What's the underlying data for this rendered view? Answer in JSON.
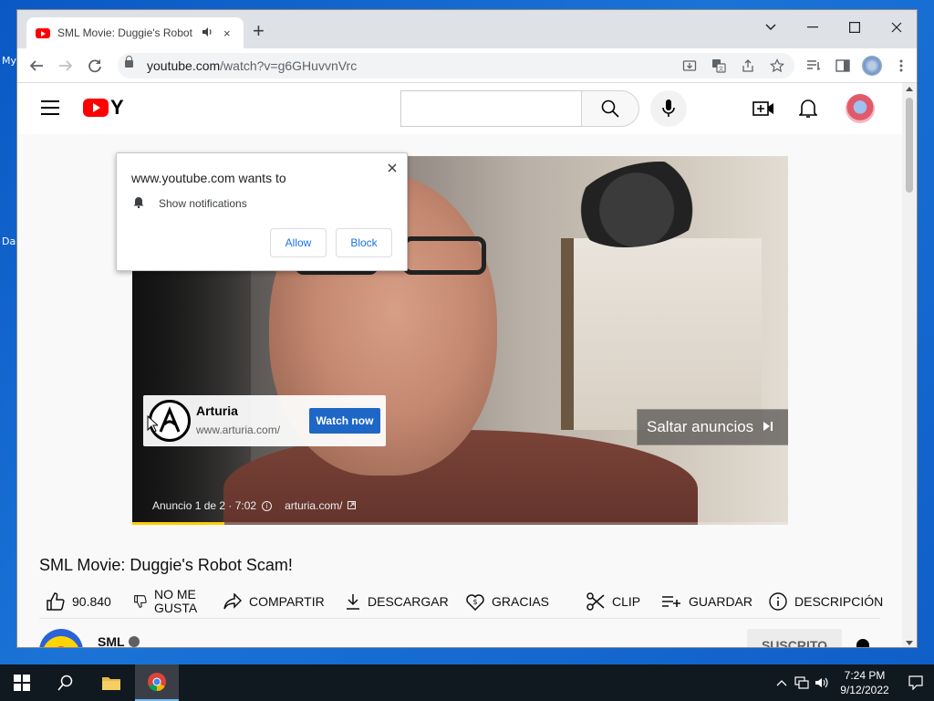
{
  "desktop": {
    "icon_labels": [
      "My",
      "Da"
    ]
  },
  "browser": {
    "tab": {
      "title": "SML Movie: Duggie's Robot Scam!",
      "audio_icon": "speaker-icon",
      "close": "×"
    },
    "new_tab": "+",
    "window_controls": [
      "tab-search-icon",
      "minimize-icon",
      "maximize-icon",
      "close-icon"
    ],
    "address": {
      "host": "youtube.com",
      "path": "/watch?v=g6GHuvvnVrc"
    },
    "omnibox_icons": [
      "install-icon",
      "translate-icon",
      "share-icon",
      "bookmark-star-icon"
    ],
    "toolbar_icons": [
      "reading-list-icon",
      "side-panel-icon",
      "profile-avatar",
      "menu-dots-icon"
    ]
  },
  "notification_prompt": {
    "title": "www.youtube.com wants to",
    "permission": "Show notifications",
    "allow_label": "Allow",
    "block_label": "Block"
  },
  "youtube": {
    "logo_word": "Y",
    "search": {
      "placeholder": ""
    },
    "header_icons": [
      "create-video-icon",
      "notifications-bell-icon",
      "account-avatar"
    ]
  },
  "video": {
    "ad": {
      "advertiser": "Arturia",
      "url": "www.arturia.com/",
      "cta": "Watch now",
      "skip_label": "Saltar anuncios",
      "info_text": "Anuncio 1 de 2 · 7:02",
      "info_link": "arturia.com/",
      "progress": 0.14
    },
    "title": "SML Movie: Duggie's Robot Scam!",
    "actions": {
      "likes": "90.840",
      "dislike_line1": "NO ME",
      "dislike_line2": "GUSTA",
      "share": "COMPARTIR",
      "download": "DESCARGAR",
      "thanks": "GRACIAS",
      "clip": "CLIP",
      "save": "GUARDAR",
      "description": "DESCRIPCIÓN",
      "more": "..."
    },
    "channel": {
      "name": "SML",
      "subscribe_label": "SUSCRITO"
    }
  },
  "taskbar": {
    "apps": [
      "start-icon",
      "search-icon",
      "file-explorer-icon",
      "chrome-icon"
    ],
    "clock": {
      "time": "7:24 PM",
      "date": "9/12/2022"
    }
  },
  "colors": {
    "youtube_red": "#ff0000",
    "chrome_blue": "#1a73e8",
    "ad_cta": "#1f67c6",
    "ad_progress": "#ffcc00",
    "desktop_blue": "#1566c9"
  }
}
